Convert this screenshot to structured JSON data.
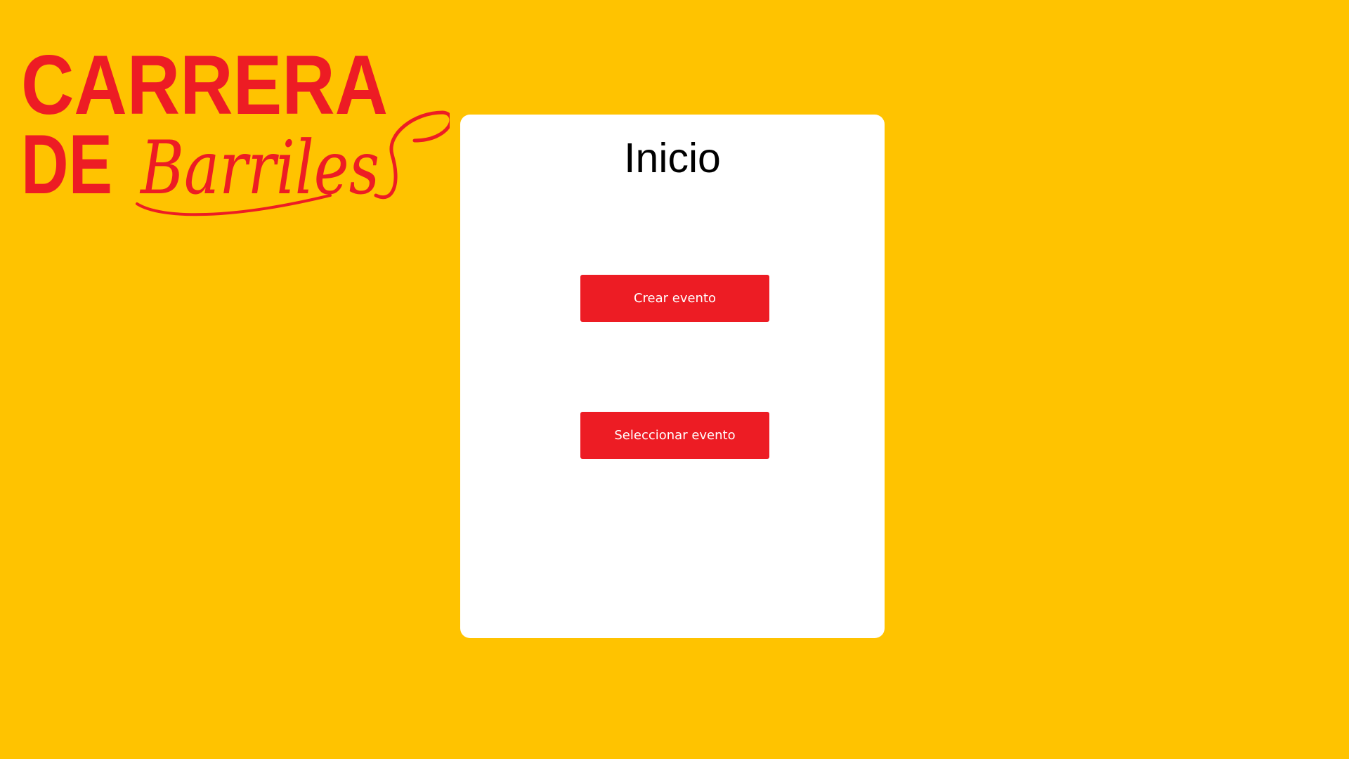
{
  "logo": {
    "line1": "CARRERA",
    "line2_block": "DE",
    "line2_script": "Barriles",
    "color": "#ED1C24"
  },
  "colors": {
    "background": "#FFC300",
    "panel": "#FFFFFF",
    "button": "#ED1C24",
    "button_text": "#FFFFFF"
  },
  "panel": {
    "title": "Inicio"
  },
  "actions": {
    "create_label": "Crear evento",
    "select_label": "Seleccionar evento"
  }
}
